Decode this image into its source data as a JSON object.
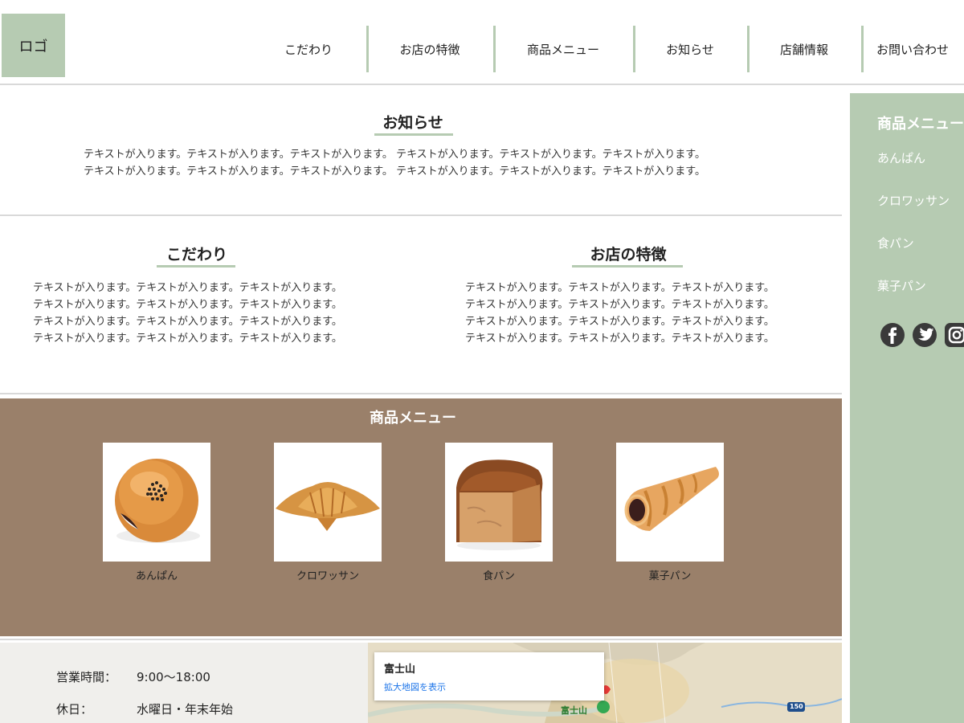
{
  "header": {
    "logo": "ロゴ",
    "nav": [
      "こだわり",
      "お店の特徴",
      "商品メニュー",
      "お知らせ",
      "店舗情報",
      "お問い合わせ"
    ]
  },
  "news": {
    "title": "お知らせ",
    "text": "テキストが入ります。テキストが入ります。テキストが入ります。 テキストが入ります。テキストが入ります。テキストが入ります。\nテキストが入ります。テキストが入ります。テキストが入ります。 テキストが入ります。テキストが入ります。テキストが入ります。"
  },
  "commitment": {
    "title": "こだわり",
    "text": "テキストが入ります。テキストが入ります。テキストが入ります。\nテキストが入ります。テキストが入ります。テキストが入ります。\nテキストが入ります。テキストが入ります。テキストが入ります。\nテキストが入ります。テキストが入ります。テキストが入ります。"
  },
  "features": {
    "title": "お店の特徴",
    "text": "テキストが入ります。テキストが入ります。テキストが入ります。\nテキストが入ります。テキストが入ります。テキストが入ります。\nテキストが入ります。テキストが入ります。テキストが入ります。\nテキストが入ります。テキストが入ります。テキストが入ります。"
  },
  "menu": {
    "title": "商品メニュー",
    "products": [
      "あんぱん",
      "クロワッサン",
      "食パン",
      "菓子パン"
    ]
  },
  "info": {
    "hours_label": "営業時間：",
    "hours_value": "9:00〜18:00",
    "holiday_label": "休日：",
    "holiday_value": "水曜日・年末年始",
    "map_place": "富士山",
    "map_link": "拡大地図を表示",
    "map_pin_label": "富士山",
    "map_road": "150"
  },
  "sidebar": {
    "title": "商品メニュー",
    "items": [
      "あんぱん",
      "クロワッサン",
      "食パン",
      "菓子パン"
    ],
    "social": [
      "facebook-icon",
      "twitter-icon",
      "instagram-icon"
    ]
  },
  "colors": {
    "accent_green": "#b6cbb2",
    "menu_brown": "#9a806a",
    "divider": "#d9d9d9"
  }
}
